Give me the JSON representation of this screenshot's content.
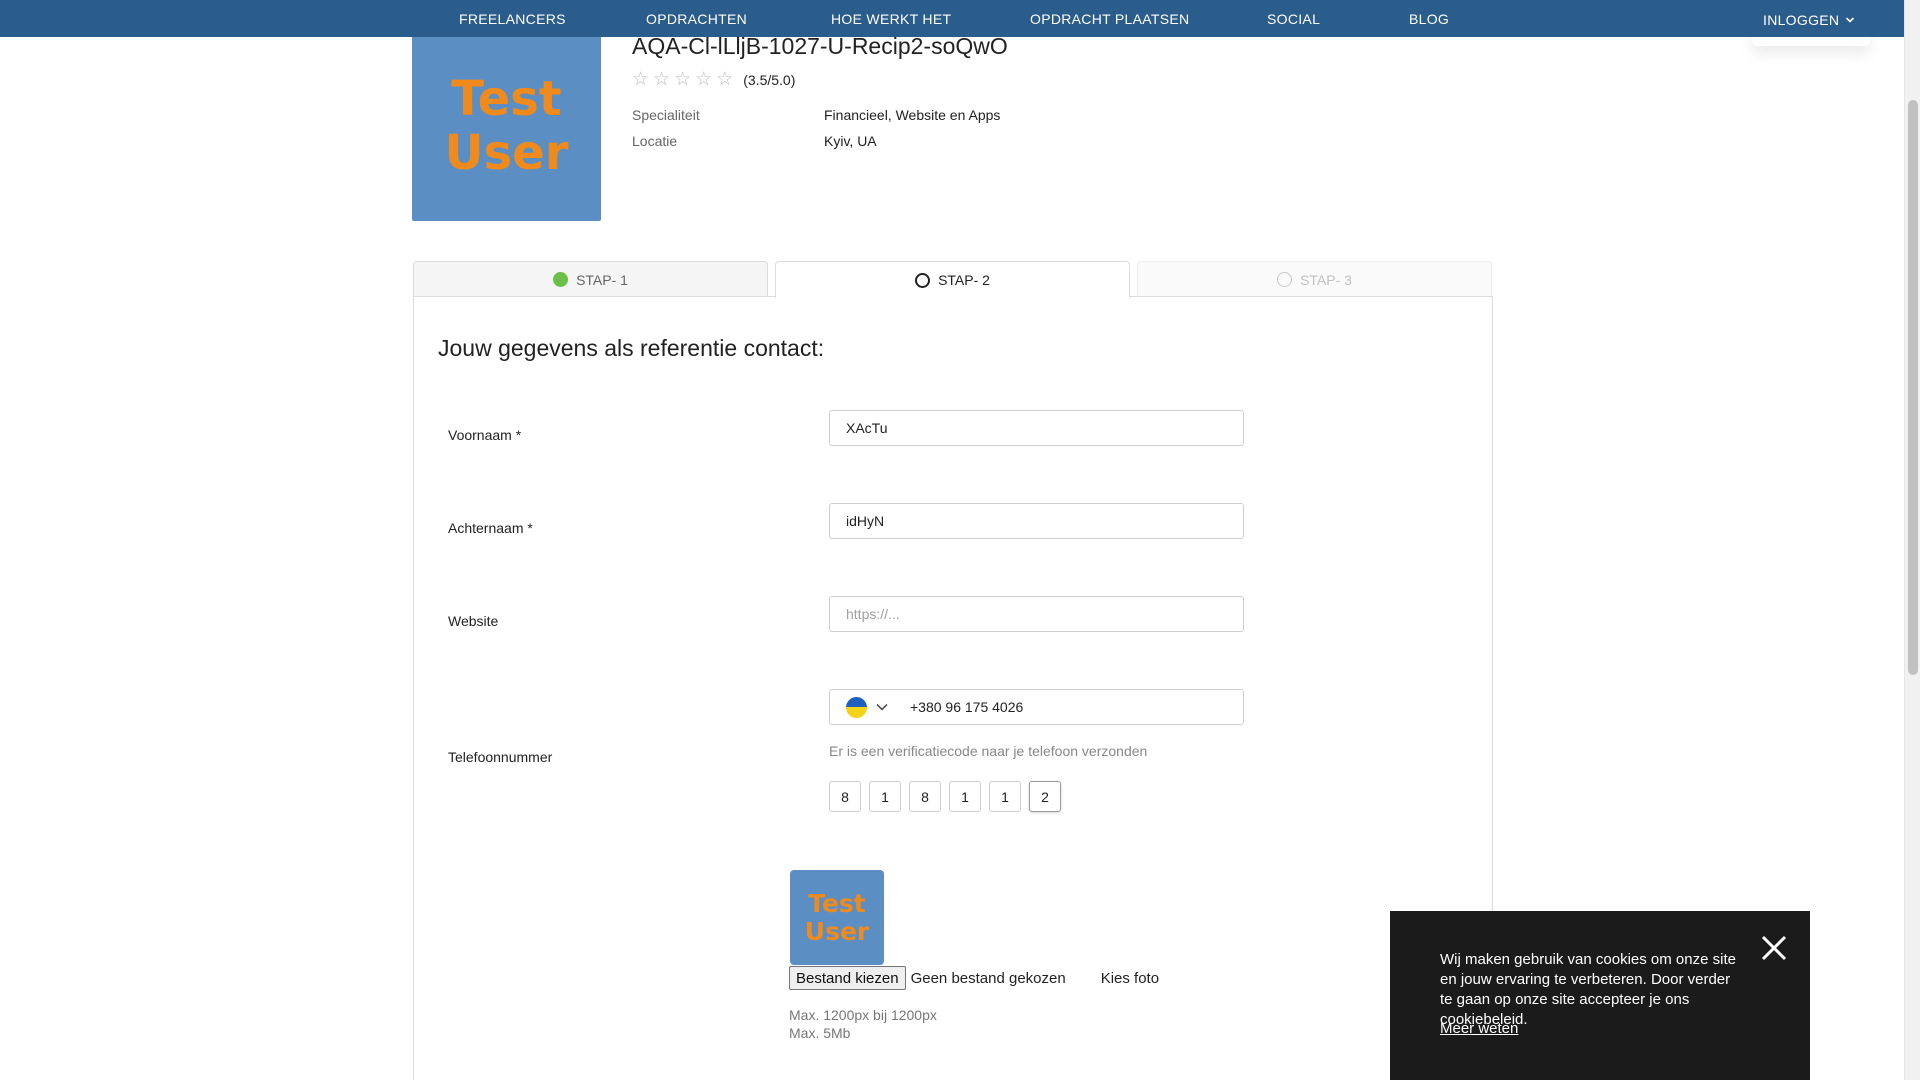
{
  "nav": {
    "items": [
      "FREELANCERS",
      "OPDRACHTEN",
      "HOE WERKT HET",
      "OPDRACHT PLAATSEN",
      "SOCIAL",
      "BLOG"
    ],
    "login_label": "INLOGGEN",
    "color": "#2a5d8b"
  },
  "profile": {
    "avatar_text_line1": "Test",
    "avatar_text_line2": "User",
    "name": "AQA-Cl-lLljB-1027-U-Recip2-soQwO",
    "rating_text": "(3.5/5.0)",
    "rating_value": 3.5,
    "rating_max": 5,
    "specialty_label": "Specialiteit",
    "specialty_value": "Financieel, Website en Apps",
    "location_label": "Locatie",
    "location_value": "Kyiv, UA"
  },
  "steps": [
    {
      "label": "STAP- 1",
      "state": "done",
      "color": "#6cc04a"
    },
    {
      "label": "STAP- 2",
      "state": "active"
    },
    {
      "label": "STAP- 3",
      "state": "future"
    }
  ],
  "form": {
    "title": "Jouw gegevens als referentie contact:",
    "first_name_label": "Voornaam *",
    "first_name_value": "XAcTu",
    "last_name_label": "Achternaam *",
    "last_name_value": "idHyN",
    "website_label": "Website",
    "website_placeholder": "https://...",
    "phone_label": "Telefoonnummer",
    "phone_value": "+380 96 175 4026",
    "phone_country_icon": "ukraine-flag-icon",
    "verify_note": "Er is een verificatiecode naar je telefoon verzonden",
    "code_digits": [
      "8",
      "1",
      "8",
      "1",
      "1",
      "2"
    ],
    "file_button_label": "Bestand kiezen",
    "file_status": "Geen bestand gekozen",
    "choose_photo_label": "Kies foto",
    "limit_size": "Max. 1200px bij 1200px",
    "limit_weight": "Max. 5Mb"
  },
  "cookie": {
    "text": "Wij maken gebruik van cookies om onze site en jouw ervaring te verbeteren. Door verder te gaan op onze site accepteer je ons cookiebeleid.",
    "link_label": "Meer weten",
    "close_icon": "close-icon"
  }
}
